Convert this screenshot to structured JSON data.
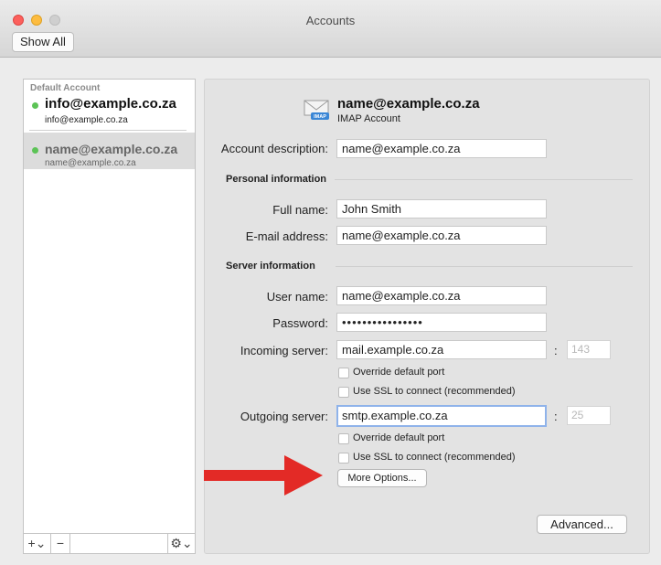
{
  "window": {
    "title": "Accounts"
  },
  "toolbar": {
    "show_all_label": "Show All"
  },
  "sidebar": {
    "section_label": "Default Account",
    "accounts": [
      {
        "name": "info@example.co.za",
        "sub": "info@example.co.za",
        "status": "online"
      },
      {
        "name": "name@example.co.za",
        "sub": "name@example.co.za",
        "status": "online"
      }
    ],
    "add_label": "+⌄",
    "remove_label": "−",
    "gear_label": "⚙⌄"
  },
  "account": {
    "email": "name@example.co.za",
    "type": "IMAP Account",
    "icon_badge": "IMAP",
    "description_label": "Account description:",
    "description_value": "name@example.co.za",
    "personal_section": "Personal information",
    "full_name_label": "Full name:",
    "full_name_value": "John Smith",
    "email_label": "E-mail address:",
    "email_value": "name@example.co.za",
    "server_section": "Server information",
    "username_label": "User name:",
    "username_value": "name@example.co.za",
    "password_label": "Password:",
    "password_value": "••••••••••••••••",
    "incoming_label": "Incoming server:",
    "incoming_value": "mail.example.co.za",
    "incoming_port": "143",
    "outgoing_label": "Outgoing server:",
    "outgoing_value": "smtp.example.co.za",
    "outgoing_port": "25",
    "colon": ":",
    "override_port_label": "Override default port",
    "ssl_label": "Use SSL to connect (recommended)",
    "more_options_label": "More Options...",
    "advanced_label": "Advanced..."
  },
  "colors": {
    "status_online": "#5cc356",
    "annotation_arrow": "#e32a26",
    "focus_ring": "#8fb3ea"
  }
}
